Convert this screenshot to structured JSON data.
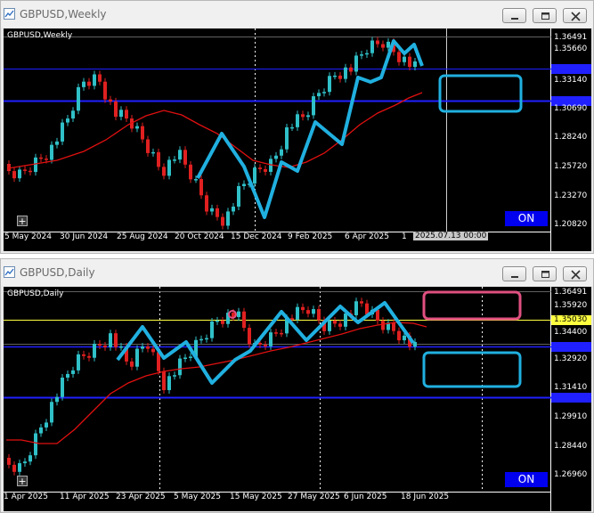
{
  "weekly": {
    "title": "GBPUSD,Weekly",
    "symbol_label": "GBPUSD,Weekly",
    "on_label": "ON",
    "crosshair_time": "2025.07.13 00:00",
    "price_axis": [
      "1.36491",
      "1.35660",
      "1.33140",
      "1.30690",
      "1.28240",
      "1.25720",
      "1.23270",
      "1.20820"
    ],
    "date_axis": [
      "5 May 2024",
      "30 Jun 2024",
      "25 Aug 2024",
      "20 Oct 2024",
      "15 Dec 2024",
      "9 Feb 2025",
      "6 Apr 2025",
      "1"
    ]
  },
  "daily": {
    "title": "GBPUSD,Daily",
    "symbol_label": "GBPUSD,Daily",
    "on_label": "ON",
    "price_axis": [
      "1.36491",
      "1.35920",
      "1.35030",
      "1.34400",
      "1.32920",
      "1.31410",
      "1.29910",
      "1.28440",
      "1.26960"
    ],
    "date_axis": [
      "1 Apr 2025",
      "11 Apr 2025",
      "23 Apr 2025",
      "5 May 2025",
      "15 May 2025",
      "27 May 2025",
      "6 Jun 2025",
      "18 Jun 2025"
    ]
  },
  "colors": {
    "bull": "#30c0c8",
    "bear": "#e02020",
    "ma": "#e01010",
    "zigzag": "#20b0e0",
    "hline_blue": "#2020ff",
    "hline_yellow": "#ffff40",
    "box_blue": "#20b0e0",
    "box_pink": "#e05080"
  }
}
